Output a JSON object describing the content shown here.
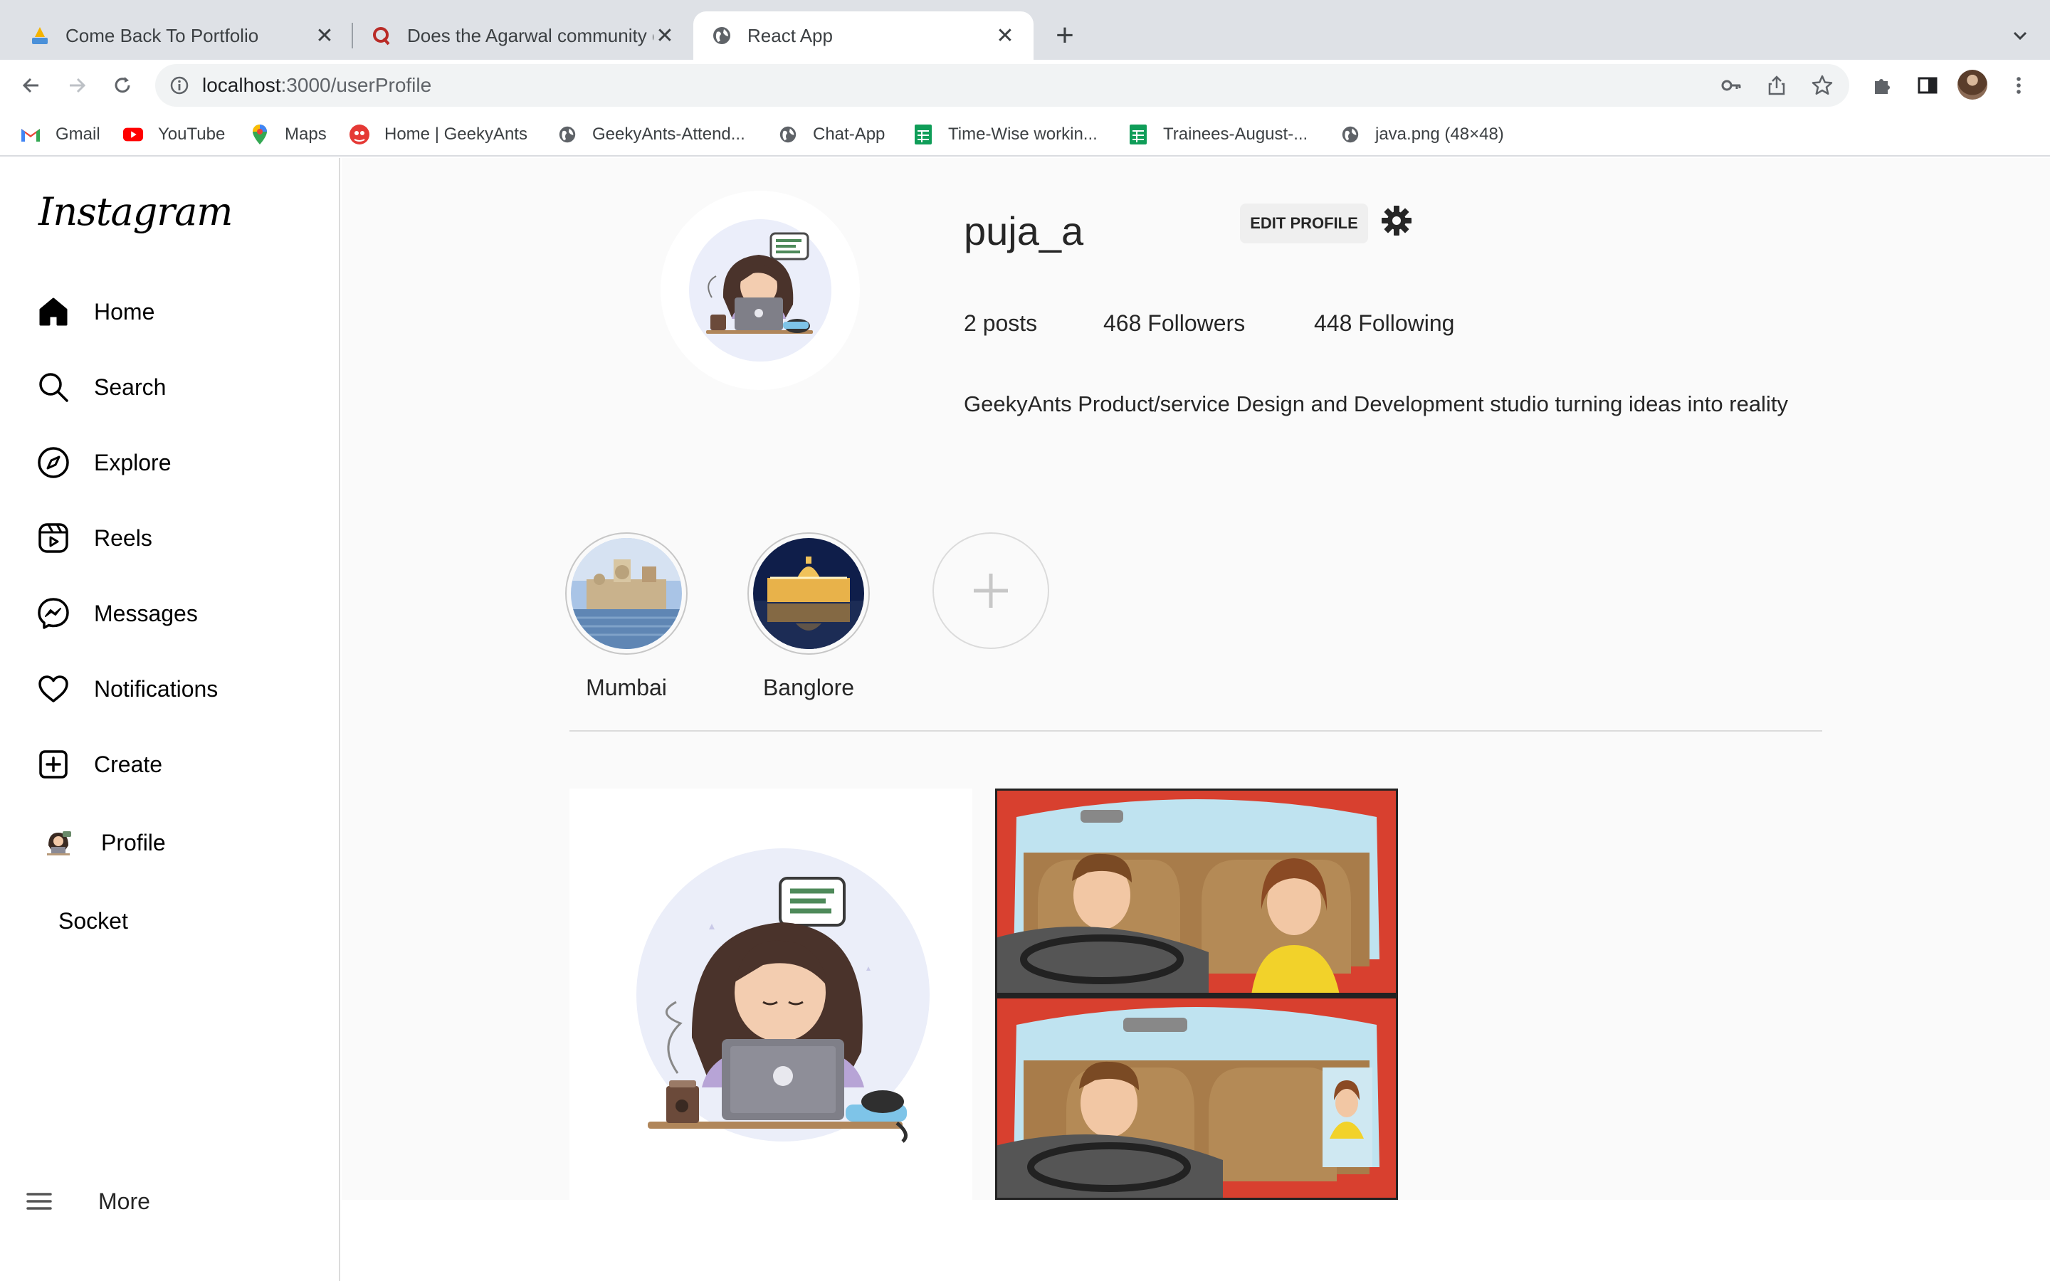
{
  "browser": {
    "tabs": [
      {
        "title": "Come Back To Portfolio",
        "favicon": "portfolio-icon",
        "active": false
      },
      {
        "title": "Does the Agarwal community c",
        "favicon": "quora-icon",
        "active": false
      },
      {
        "title": "React App",
        "favicon": "globe-icon",
        "active": true
      }
    ],
    "new_tab_label": "+",
    "url_host": "localhost",
    "url_path": ":3000/userProfile",
    "bookmarks": [
      {
        "label": "Gmail",
        "icon": "gmail-icon"
      },
      {
        "label": "YouTube",
        "icon": "youtube-icon"
      },
      {
        "label": "Maps",
        "icon": "maps-icon"
      },
      {
        "label": "Home | GeekyAnts",
        "icon": "geekyants-icon"
      },
      {
        "label": "GeekyAnts-Attend...",
        "icon": "globe-icon"
      },
      {
        "label": "Chat-App",
        "icon": "globe-icon"
      },
      {
        "label": "Time-Wise workin...",
        "icon": "sheets-icon"
      },
      {
        "label": "Trainees-August-...",
        "icon": "sheets-icon"
      },
      {
        "label": "java.png (48×48)",
        "icon": "globe-icon"
      }
    ]
  },
  "sidebar": {
    "logo": "Instagram",
    "items": [
      {
        "label": "Home",
        "icon": "home-icon"
      },
      {
        "label": "Search",
        "icon": "search-icon"
      },
      {
        "label": "Explore",
        "icon": "compass-icon"
      },
      {
        "label": "Reels",
        "icon": "reels-icon"
      },
      {
        "label": "Messages",
        "icon": "messenger-icon"
      },
      {
        "label": "Notifications",
        "icon": "heart-icon"
      },
      {
        "label": "Create",
        "icon": "plus-square-icon"
      },
      {
        "label": "Profile",
        "icon": "avatar"
      },
      {
        "label": "Socket",
        "icon": ""
      }
    ],
    "more_label": "More"
  },
  "profile": {
    "username": "puja_a",
    "edit_label": "EDIT PROFILE",
    "posts": "2 posts",
    "followers": "468 Followers",
    "following": "448 Following",
    "bio": "GeekyAnts Product/service Design and Development studio turning ideas into reality"
  },
  "highlights": [
    {
      "label": "Mumbai"
    },
    {
      "label": "Banglore"
    }
  ],
  "posts": [
    {
      "name": "post-girl-laptop-illustration"
    },
    {
      "name": "post-car-comic-illustration"
    }
  ]
}
